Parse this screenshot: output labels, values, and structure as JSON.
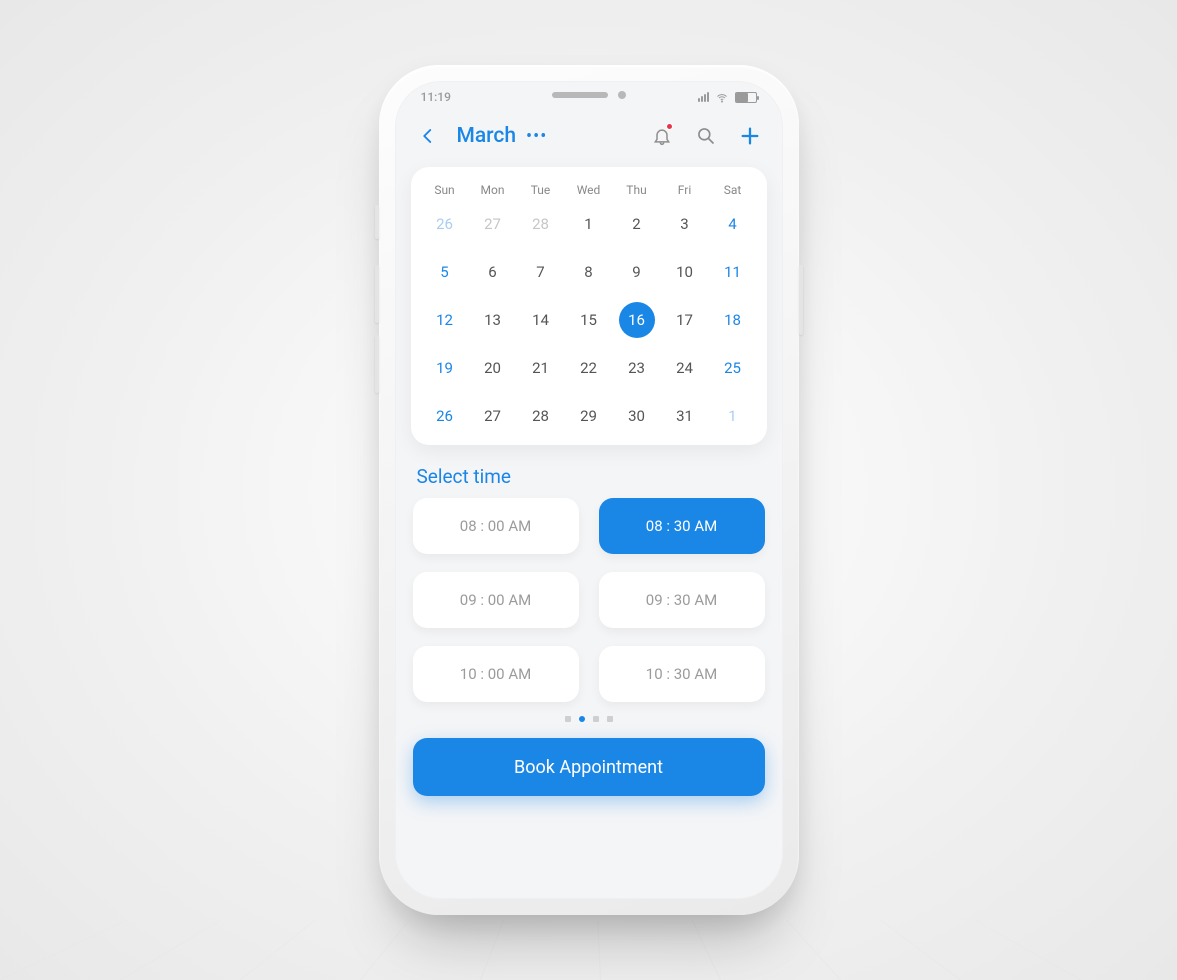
{
  "status": {
    "time": "11:19"
  },
  "header": {
    "month": "March"
  },
  "calendar": {
    "dow": [
      "Sun",
      "Mon",
      "Tue",
      "Wed",
      "Thu",
      "Fri",
      "Sat"
    ],
    "days": [
      {
        "n": "26",
        "muted": true,
        "weekend": true
      },
      {
        "n": "27",
        "muted": true
      },
      {
        "n": "28",
        "muted": true
      },
      {
        "n": "1"
      },
      {
        "n": "2"
      },
      {
        "n": "3"
      },
      {
        "n": "4",
        "weekend": true
      },
      {
        "n": "5",
        "weekend": true
      },
      {
        "n": "6"
      },
      {
        "n": "7"
      },
      {
        "n": "8"
      },
      {
        "n": "9"
      },
      {
        "n": "10"
      },
      {
        "n": "11",
        "weekend": true
      },
      {
        "n": "12",
        "weekend": true
      },
      {
        "n": "13"
      },
      {
        "n": "14"
      },
      {
        "n": "15"
      },
      {
        "n": "16",
        "selected": true
      },
      {
        "n": "17"
      },
      {
        "n": "18",
        "weekend": true
      },
      {
        "n": "19",
        "weekend": true
      },
      {
        "n": "20"
      },
      {
        "n": "21"
      },
      {
        "n": "22"
      },
      {
        "n": "23"
      },
      {
        "n": "24"
      },
      {
        "n": "25",
        "weekend": true
      },
      {
        "n": "26",
        "weekend": true
      },
      {
        "n": "27"
      },
      {
        "n": "28"
      },
      {
        "n": "29"
      },
      {
        "n": "30"
      },
      {
        "n": "31"
      },
      {
        "n": "1",
        "muted": true,
        "weekend": true
      }
    ]
  },
  "select_time_label": "Select time",
  "slots": [
    {
      "label": "08 : 00 AM",
      "selected": false
    },
    {
      "label": "08 : 30 AM",
      "selected": true
    },
    {
      "label": "09 : 00 AM",
      "selected": false
    },
    {
      "label": "09 : 30 AM",
      "selected": false
    },
    {
      "label": "10 : 00 AM",
      "selected": false
    },
    {
      "label": "10 : 30 AM",
      "selected": false
    }
  ],
  "pager": {
    "count": 4,
    "active": 1
  },
  "cta_label": "Book Appointment"
}
